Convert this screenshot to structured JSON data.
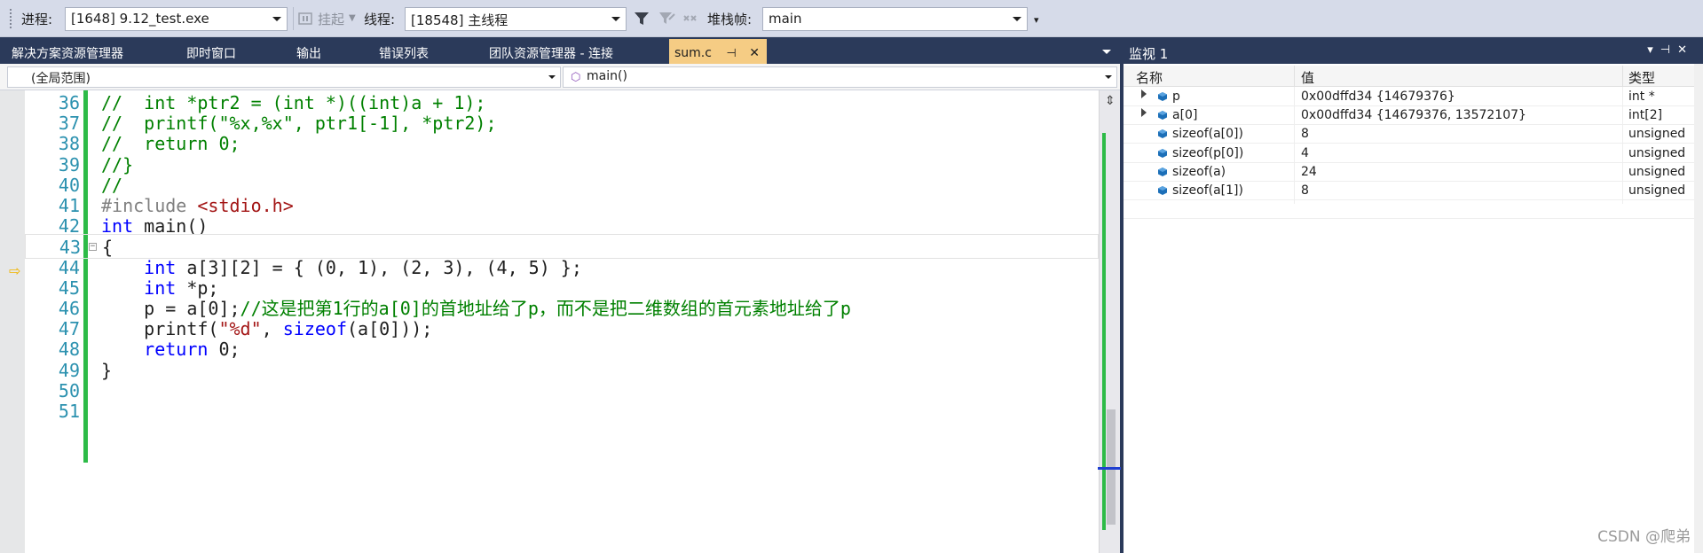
{
  "toolbar": {
    "process_label": "进程:",
    "process_value": "[1648] 9.12_test.exe",
    "suspend_label": "挂起",
    "thread_label": "线程:",
    "thread_value": "[18548] 主线程",
    "stackframe_label": "堆栈帧:",
    "stackframe_value": "main"
  },
  "doc_tabs": [
    "解决方案资源管理器",
    "即时窗口",
    "输出",
    "错误列表",
    "团队资源管理器 - 连接",
    "sum.c"
  ],
  "nav": {
    "scope": "(全局范围)",
    "function": "main()"
  },
  "code": {
    "current_line": 43,
    "lines": [
      {
        "n": "36",
        "t": "//  int *ptr2 = (int *)((int)a + 1);"
      },
      {
        "n": "37",
        "t": "//  printf(\"%x,%x\", ptr1[-1], *ptr2);"
      },
      {
        "n": "38",
        "t": "//  return 0;"
      },
      {
        "n": "39",
        "t": "//}"
      },
      {
        "n": "40",
        "t": "//"
      },
      {
        "n": "41",
        "pp": "#include",
        "inc": " <stdio.h>"
      },
      {
        "n": "42",
        "kw": "int",
        "rest": " main()"
      },
      {
        "n": "43",
        "rest": "{"
      },
      {
        "n": "44",
        "indent": "    ",
        "kw": "int",
        "rest": " a[3][2] = { (0, 1), (2, 3), (4, 5) };"
      },
      {
        "n": "45",
        "indent": "    ",
        "kw": "int",
        "rest": " *p;"
      },
      {
        "n": "46",
        "indent": "    ",
        "rest": "p = a[0];",
        "com": "//这是把第1行的a[0]的首地址给了p，而不是把二维数组的首元素地址给了p"
      },
      {
        "n": "47",
        "indent": "    ",
        "fn": "printf(",
        "str": "\"%d\"",
        "rest2": ", ",
        "kw2": "sizeof",
        "rest3": "(a[0]));"
      },
      {
        "n": "48",
        "indent": "    ",
        "kw": "return",
        "rest": " 0;"
      },
      {
        "n": "49",
        "rest": "}"
      },
      {
        "n": "50"
      },
      {
        "n": "51"
      }
    ]
  },
  "watch": {
    "title": "监视 1",
    "columns": [
      "名称",
      "值",
      "类型"
    ],
    "rows": [
      {
        "name": "p",
        "value": "0x00dffd34 {14679376}",
        "type": "int *",
        "expandable": true
      },
      {
        "name": "a[0]",
        "value": "0x00dffd34 {14679376, 13572107}",
        "type": "int[2]",
        "expandable": true
      },
      {
        "name": "sizeof(a[0])",
        "value": "8",
        "type": "unsigned",
        "expandable": false
      },
      {
        "name": "sizeof(p[0])",
        "value": "4",
        "type": "unsigned",
        "expandable": false
      },
      {
        "name": "sizeof(a)",
        "value": "24",
        "type": "unsigned",
        "expandable": false
      },
      {
        "name": "sizeof(a[1])",
        "value": "8",
        "type": "unsigned",
        "expandable": false
      }
    ]
  },
  "watermark": "CSDN @爬弟",
  "colors": {
    "comment": "#008000",
    "keyword": "#0000ff",
    "line_number": "#2b91af",
    "active_tab": "#f5cc84"
  }
}
